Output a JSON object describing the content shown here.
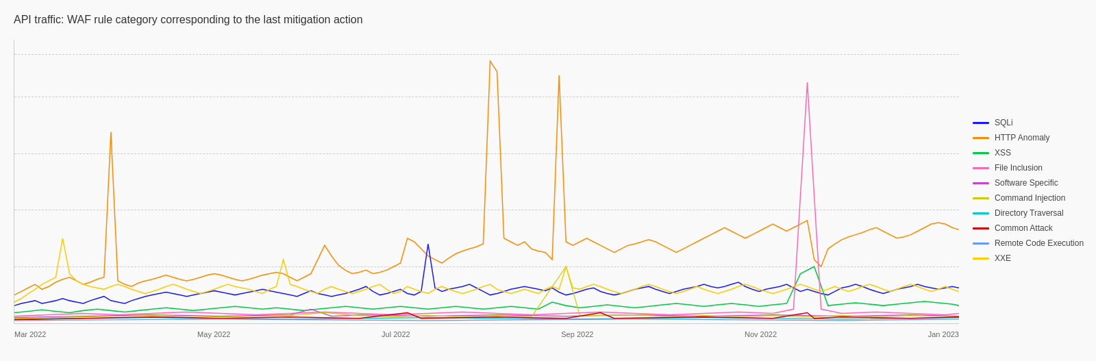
{
  "title": "API traffic: WAF rule category corresponding to the last mitigation action",
  "legend": {
    "items": [
      {
        "label": "SQLi",
        "color": "#1a1aff"
      },
      {
        "label": "HTTP Anomaly",
        "color": "#ff8c00"
      },
      {
        "label": "XSS",
        "color": "#00cc44"
      },
      {
        "label": "File Inclusion",
        "color": "#ff69b4"
      },
      {
        "label": "Software Specific",
        "color": "#cc44cc"
      },
      {
        "label": "Command Injection",
        "color": "#cccc00"
      },
      {
        "label": "Directory Traversal",
        "color": "#00cccc"
      },
      {
        "label": "Common Attack",
        "color": "#cc0000"
      },
      {
        "label": "Remote Code Execution",
        "color": "#6699ff"
      },
      {
        "label": "XXE",
        "color": "#ffcc00"
      }
    ]
  },
  "xLabels": [
    "Mar 2022",
    "May 2022",
    "Jul 2022",
    "Sep 2022",
    "Nov 2022",
    "Jan 2023"
  ],
  "gridLines": [
    0,
    20,
    40,
    60,
    80,
    100
  ]
}
